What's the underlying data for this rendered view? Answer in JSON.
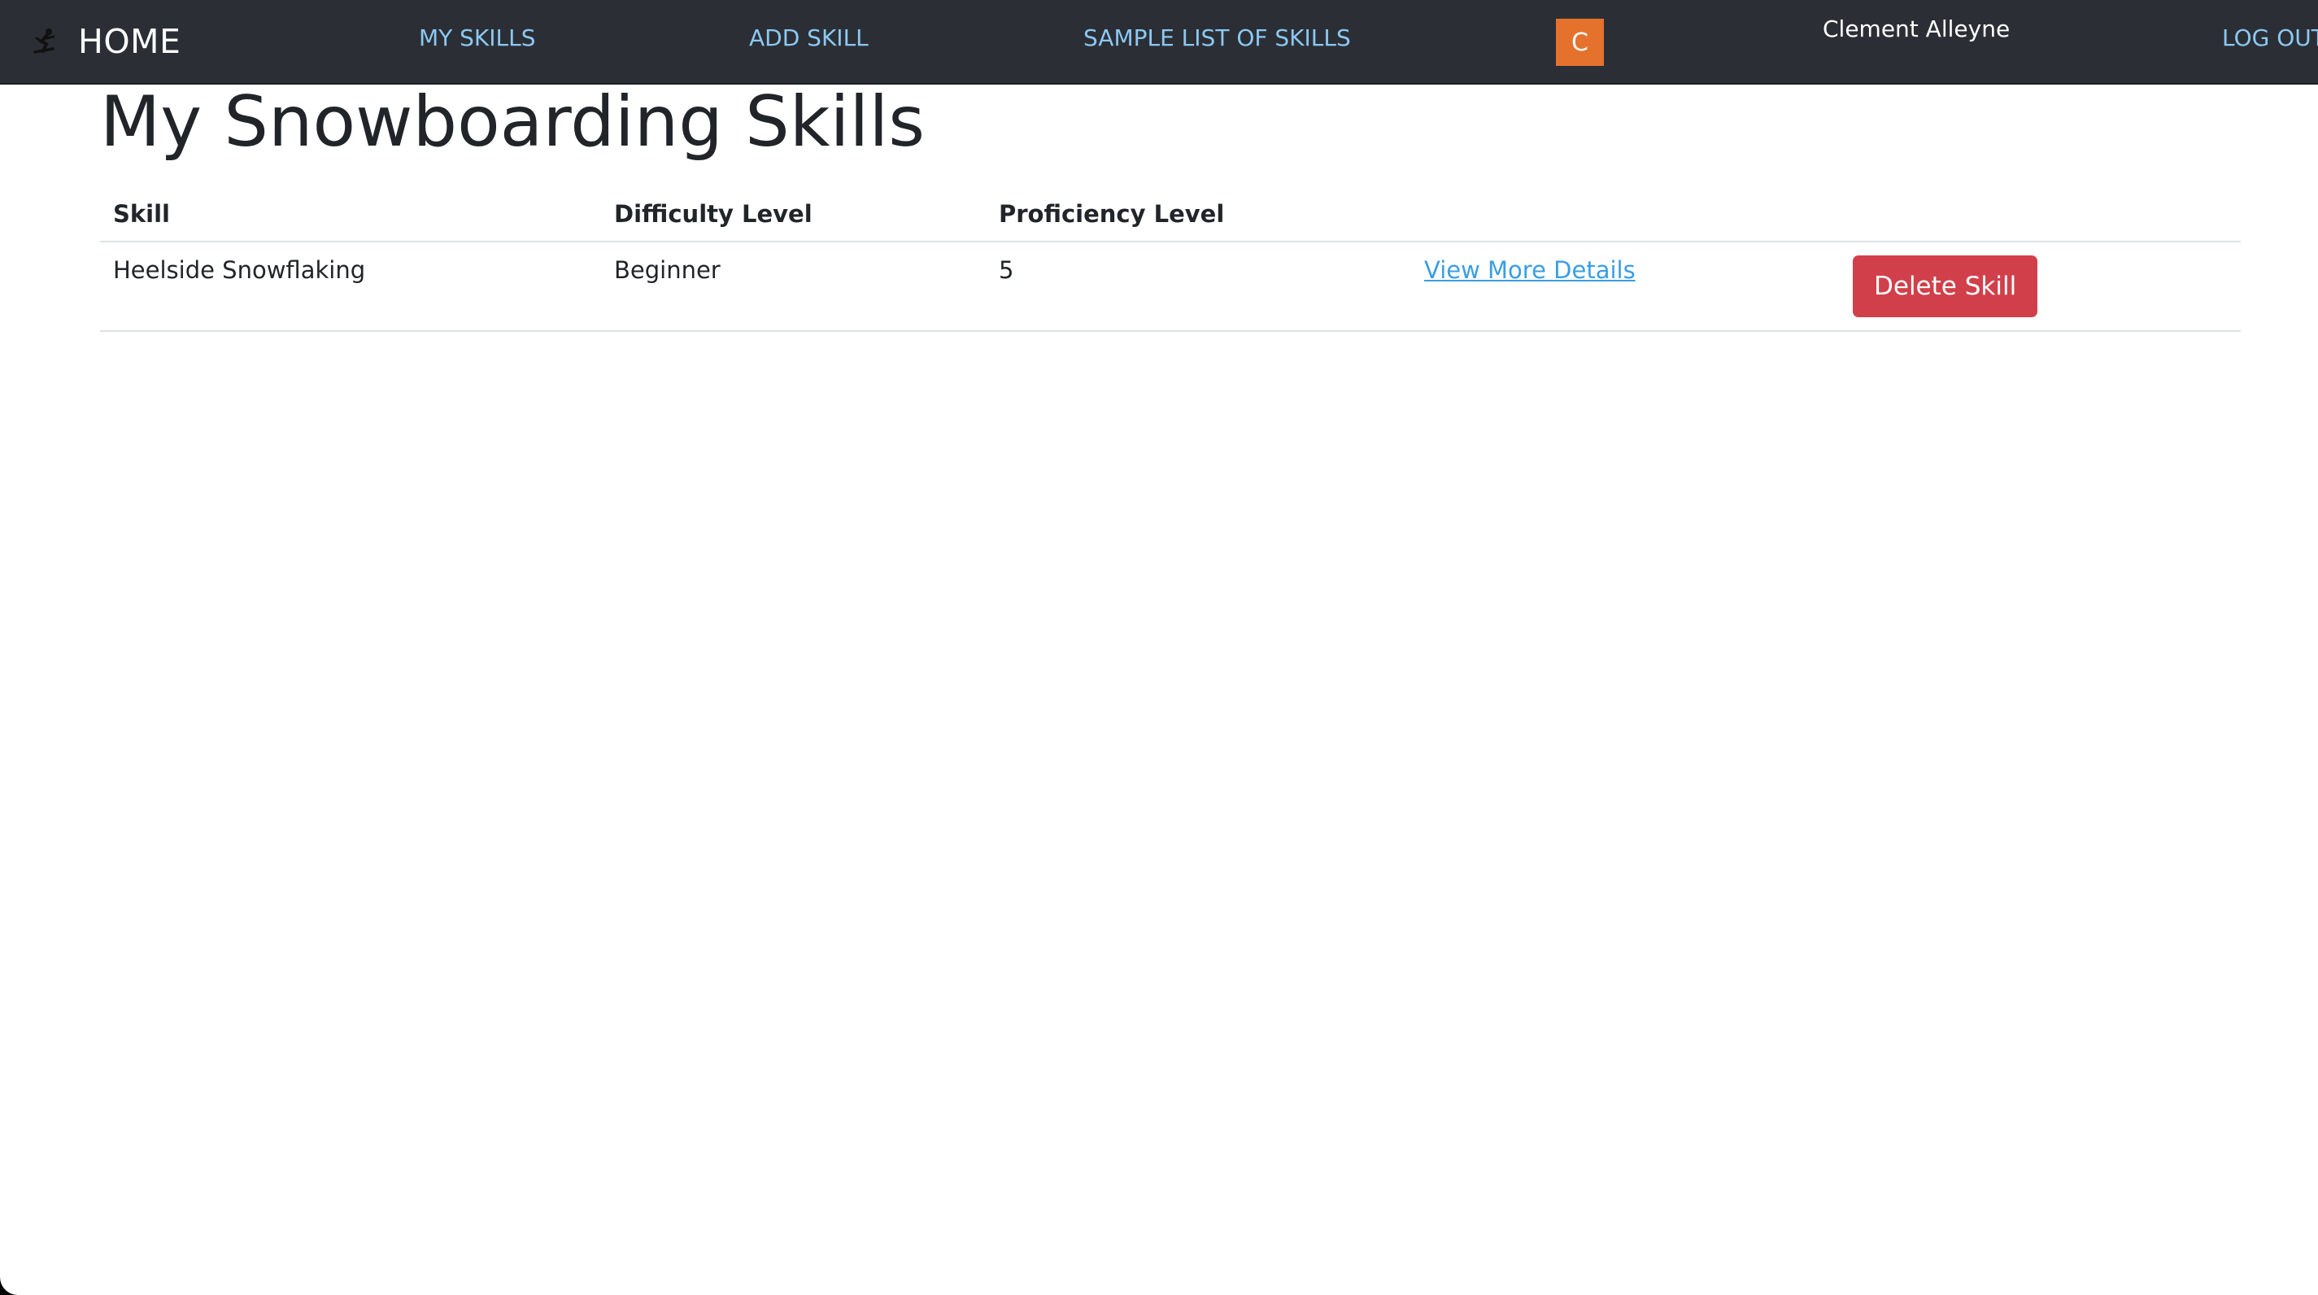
{
  "navbar": {
    "brand_icon": "snowboarder-icon",
    "brand_label": "HOME",
    "links": {
      "my_skills": "MY SKILLS",
      "add_skill": "ADD SKILL",
      "sample_list": "SAMPLE LIST OF SKILLS",
      "logout": "LOG OUT"
    },
    "avatar_initial": "C",
    "avatar_color": "#e4722d",
    "username": "Clement Alleyne"
  },
  "main": {
    "title": "My Snowboarding Skills",
    "table": {
      "headers": [
        "Skill",
        "Difficulty Level",
        "Proficiency Level",
        "",
        ""
      ],
      "rows": [
        {
          "skill": "Heelside Snowflaking",
          "difficulty": "Beginner",
          "proficiency": "5",
          "details_link": "View More Details",
          "delete_label": "Delete Skill"
        }
      ]
    }
  },
  "colors": {
    "navbar_bg": "#2b2f35",
    "nav_link": "#8cc8f2",
    "link": "#3a9ee4",
    "danger": "#d1404a"
  }
}
